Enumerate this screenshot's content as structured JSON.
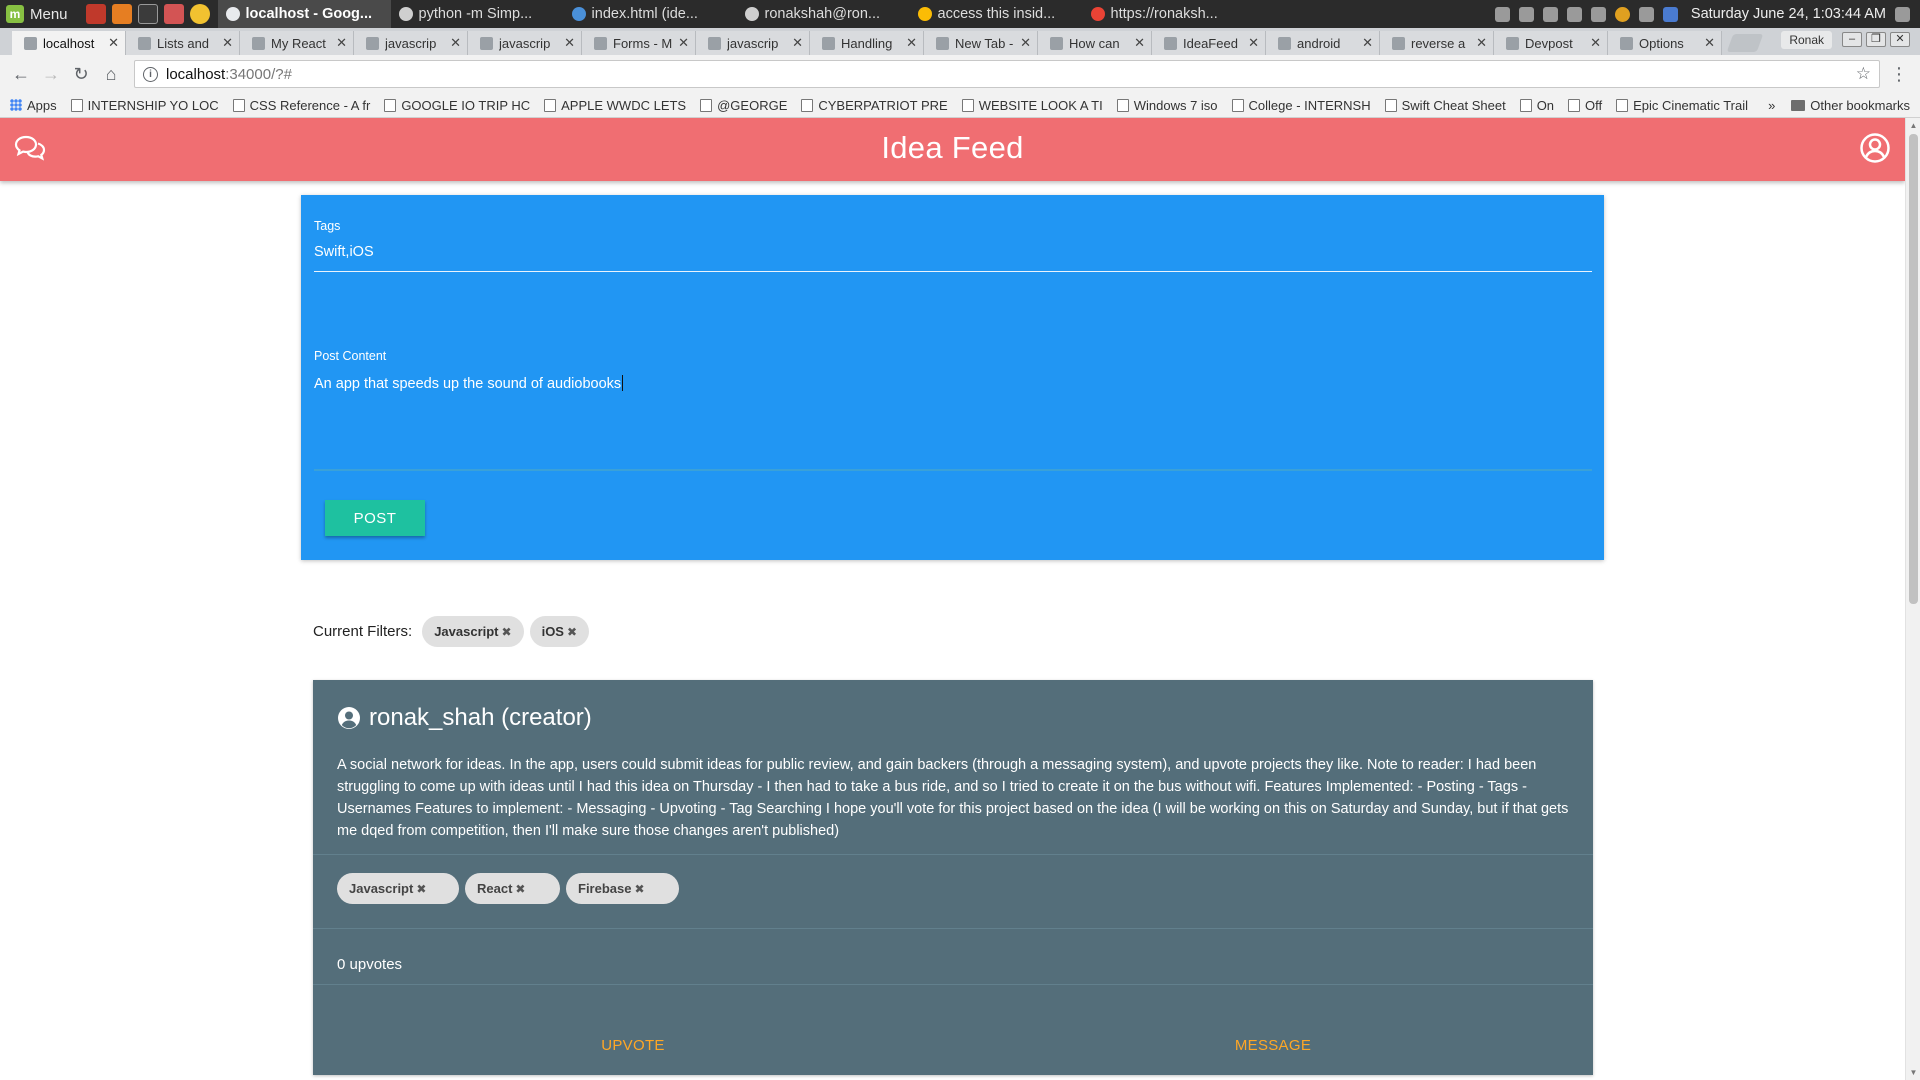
{
  "os_panel": {
    "menu_label": "Menu",
    "windows": [
      {
        "label": "localhost - Goog...",
        "active": true,
        "color": "#e8eaed"
      },
      {
        "label": "python -m Simp...",
        "active": false,
        "color": "#cfcfcf"
      },
      {
        "label": "index.html (ide...",
        "active": false,
        "color": "#4a90d9"
      },
      {
        "label": "ronakshah@ron...",
        "active": false,
        "color": "#cfcfcf"
      },
      {
        "label": "access this insid...",
        "active": false,
        "color": "#fbbc05"
      },
      {
        "label": "https://ronaksh...",
        "active": false,
        "color": "#ea4335"
      }
    ],
    "clock": "Saturday June 24,  1:03:44 AM"
  },
  "tabs": [
    {
      "label": "localhost",
      "active": true
    },
    {
      "label": "Lists and",
      "active": false
    },
    {
      "label": "My React",
      "active": false
    },
    {
      "label": "javascrip",
      "active": false
    },
    {
      "label": "javascrip",
      "active": false
    },
    {
      "label": "Forms - M",
      "active": false
    },
    {
      "label": "javascrip",
      "active": false
    },
    {
      "label": "Handling",
      "active": false
    },
    {
      "label": "New Tab - To",
      "active": false
    },
    {
      "label": "How can",
      "active": false
    },
    {
      "label": "IdeaFeed",
      "active": false
    },
    {
      "label": "android",
      "active": false
    },
    {
      "label": "reverse a",
      "active": false
    },
    {
      "label": "Devpost",
      "active": false
    },
    {
      "label": "Options",
      "active": false
    }
  ],
  "profile_name": "Ronak",
  "omnibox": {
    "host": "localhost",
    "path": ":34000/?#"
  },
  "bookmarks": [
    "Apps",
    "INTERNSHIP YO LOC",
    "CSS Reference - A fr",
    "GOOGLE IO TRIP HC",
    "APPLE WWDC LETS",
    "@GEORGE",
    "CYBERPATRIOT PRE",
    "WEBSITE LOOK A TI",
    "Windows 7 iso",
    "College - INTERNSH",
    "Swift Cheat Sheet",
    "On",
    "Off",
    "Epic Cinematic Trail"
  ],
  "bookmarks_overflow": "»",
  "other_bookmarks": "Other bookmarks",
  "app": {
    "title": "Idea Feed",
    "colors": {
      "appbar": "#f06e72",
      "compose": "#2196f3",
      "post_button": "#1ec1a0",
      "card": "#546e7a",
      "action": "#ffa726"
    },
    "compose": {
      "tags_label": "Tags",
      "tags_value": "Swift,iOS",
      "content_label": "Post Content",
      "content_value": "An app that speeds up the sound of audiobooks",
      "post_label": "POST"
    },
    "filters": {
      "label": "Current Filters:",
      "chips": [
        "Javascript",
        "iOS"
      ]
    },
    "post": {
      "author": "ronak_shah (creator)",
      "body": "A social network for ideas. In the app, users could submit ideas for public review, and gain backers (through a messaging system), and upvote projects they like. Note to reader: I had been struggling to come up with ideas until I had this idea on Thursday - I then had to take a bus ride, and so I tried to create it on the bus without wifi. Features Implemented: - Posting - Tags - Usernames Features to implement: - Messaging - Upvoting - Tag Searching I hope you'll vote for this project based on the idea (I will be working on this on Saturday and Sunday, but if that gets me dqed from competition, then I'll make sure those changes aren't published)",
      "tags": [
        "Javascript",
        "React",
        "Firebase"
      ],
      "upvotes": "0 upvotes",
      "upvote_label": "UPVOTE",
      "message_label": "MESSAGE"
    }
  }
}
